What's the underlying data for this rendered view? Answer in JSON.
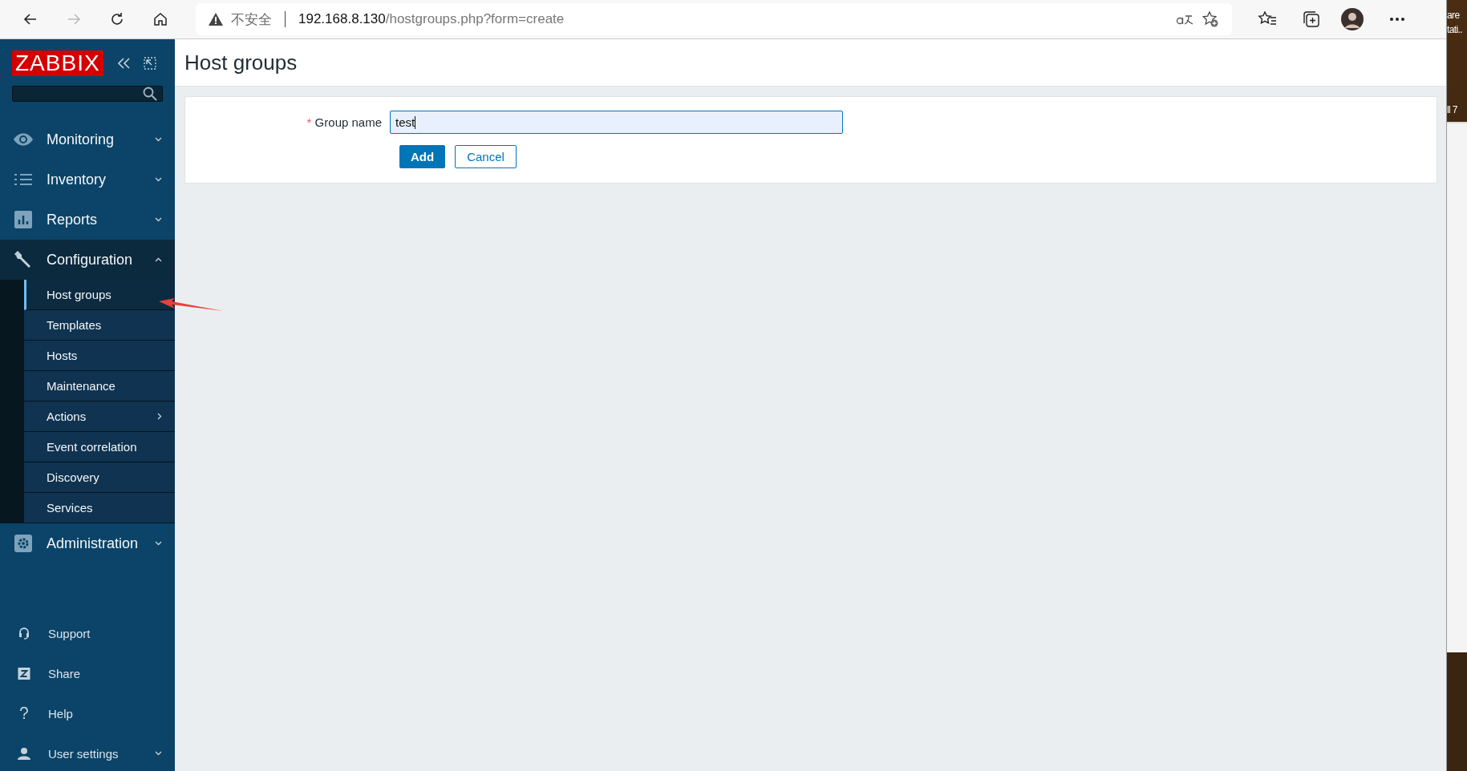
{
  "browser": {
    "nav": [
      {
        "kind": "back",
        "disabled": false
      },
      {
        "kind": "forward",
        "disabled": true
      },
      {
        "kind": "reload",
        "disabled": false
      },
      {
        "kind": "home",
        "disabled": false
      }
    ],
    "address": {
      "warning": "不安全",
      "host": "192.168.8.130",
      "path": "/hostgroups.php?form=create"
    }
  },
  "sidebar": {
    "logo": "ZABBIX",
    "menu": [
      {
        "label": "Monitoring",
        "expanded": false
      },
      {
        "label": "Inventory",
        "expanded": false
      },
      {
        "label": "Reports",
        "expanded": false
      },
      {
        "label": "Configuration",
        "expanded": true,
        "children": [
          {
            "label": "Host groups",
            "selected": true,
            "has_submenu": false
          },
          {
            "label": "Templates",
            "selected": false,
            "has_submenu": false
          },
          {
            "label": "Hosts",
            "selected": false,
            "has_submenu": false
          },
          {
            "label": "Maintenance",
            "selected": false,
            "has_submenu": false
          },
          {
            "label": "Actions",
            "selected": false,
            "has_submenu": true
          },
          {
            "label": "Event correlation",
            "selected": false,
            "has_submenu": false
          },
          {
            "label": "Discovery",
            "selected": false,
            "has_submenu": false
          },
          {
            "label": "Services",
            "selected": false,
            "has_submenu": false
          }
        ]
      },
      {
        "label": "Administration",
        "expanded": false
      }
    ],
    "bottom": [
      {
        "label": "Support",
        "kind": "link"
      },
      {
        "label": "Share",
        "kind": "link"
      },
      {
        "label": "Help",
        "kind": "link"
      },
      {
        "label": "User settings",
        "kind": "menu",
        "expanded": false
      }
    ]
  },
  "page": {
    "title": "Host groups",
    "form": {
      "field": {
        "label": "Group name",
        "required_mark": "*",
        "value": "test"
      },
      "buttons": [
        {
          "label": "Add",
          "kind": "primary"
        },
        {
          "label": "Cancel",
          "kind": "secondary"
        }
      ]
    }
  },
  "desktop_edge": [
    "are",
    "tati..",
    "ll 7"
  ]
}
